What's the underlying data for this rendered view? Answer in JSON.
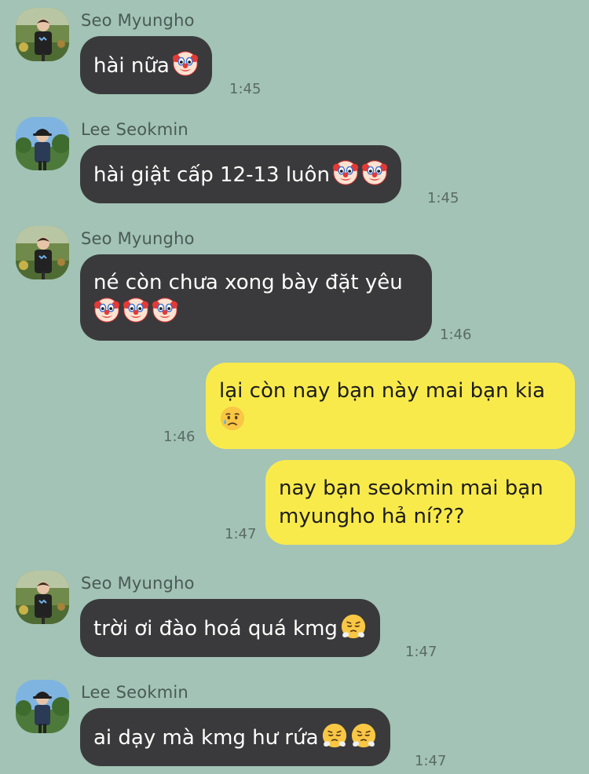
{
  "contacts": {
    "seo": "Seo Myungho",
    "lee": "Lee Seokmin"
  },
  "messages": [
    {
      "sender": "Seo Myungho",
      "text": "hài nữa",
      "emojis": [
        "clown-face"
      ],
      "time": "1:45"
    },
    {
      "sender": "Lee Seokmin",
      "text": "hài giật cấp 12-13 luôn",
      "emojis": [
        "clown-face",
        "clown-face"
      ],
      "time": "1:45"
    },
    {
      "sender": "Seo Myungho",
      "text": "né còn chưa xong bày đặt yêu",
      "emojis": [
        "clown-face",
        "clown-face",
        "clown-face"
      ],
      "time": "1:46"
    },
    {
      "sender": "me",
      "text": "lại còn nay bạn này mai bạn kia",
      "emojis": [
        "sad-sweat-face"
      ],
      "time": "1:46"
    },
    {
      "sender": "me",
      "text": "nay bạn seokmin mai bạn myungho hả ní???",
      "emojis": [],
      "time": "1:47"
    },
    {
      "sender": "Seo Myungho",
      "text": "trời ơi đào hoá quá kmg",
      "emojis": [
        "steam-nose-face"
      ],
      "time": "1:47"
    },
    {
      "sender": "Lee Seokmin",
      "text": "ai dạy mà kmg hư rứa",
      "emojis": [
        "steam-nose-face",
        "steam-nose-face"
      ],
      "time": "1:47"
    }
  ],
  "colors": {
    "background": "#a2c3b5",
    "incoming_bubble": "#3a3a3c",
    "outgoing_bubble": "#f9ea4c"
  }
}
